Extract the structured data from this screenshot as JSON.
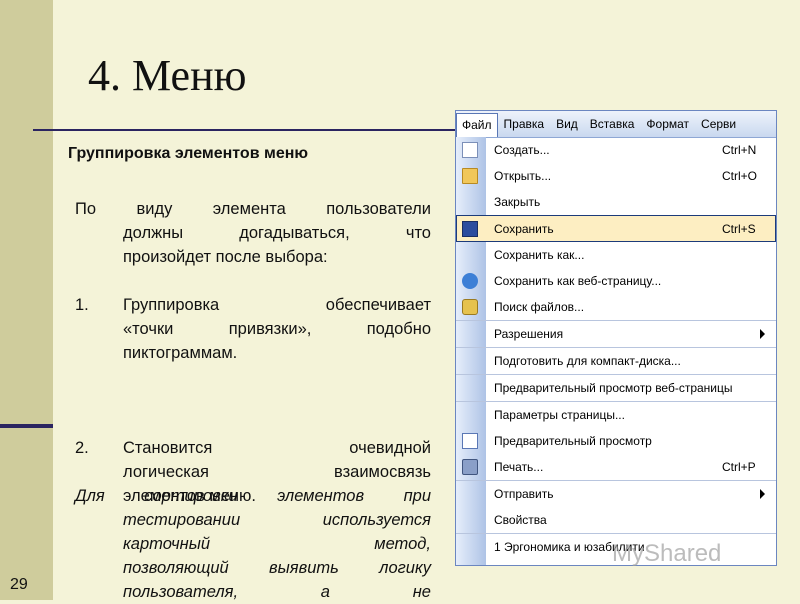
{
  "slide": {
    "title": "4. Меню",
    "subtitle": "Группировка элементов меню",
    "paragraph1": {
      "line1": "По виду элемента пользователи",
      "line2": "должны догадываться, что",
      "line3": "произойдет после выбора:"
    },
    "list": [
      {
        "num": "1.",
        "line1": "Группировка обеспечивает",
        "line2": "«точки привязки», подобно",
        "line3": "пиктограммам."
      },
      {
        "num": "2.",
        "line1": "Становится очевидной",
        "line2": "логическая взаимосвязь",
        "line3": "элементов меню."
      }
    ],
    "paragraph2": {
      "line1": "Для сортировки элементов при",
      "line2": "тестировании используется",
      "line3": "карточный метод,",
      "line4": "позволяющий выявить логику",
      "line5": "пользователя, а не"
    },
    "page_number": "29",
    "watermark": "MyShared"
  },
  "menu": {
    "menubar": [
      "Файл",
      "Правка",
      "Вид",
      "Вставка",
      "Формат",
      "Серви"
    ],
    "items": [
      {
        "label": "Создать...",
        "shortcut": "Ctrl+N",
        "icon": "new-document-icon"
      },
      {
        "label": "Открыть...",
        "shortcut": "Ctrl+O",
        "icon": "open-folder-icon"
      },
      {
        "label": "Закрыть",
        "shortcut": "",
        "icon": ""
      },
      {
        "label": "Сохранить",
        "shortcut": "Ctrl+S",
        "icon": "save-disk-icon",
        "highlighted": true
      },
      {
        "label": "Сохранить как...",
        "shortcut": "",
        "icon": ""
      },
      {
        "label": "Сохранить как веб-страницу...",
        "shortcut": "",
        "icon": "web-page-icon"
      },
      {
        "label": "Поиск файлов...",
        "shortcut": "",
        "icon": "file-search-icon"
      },
      {
        "label": "Разрешения",
        "shortcut": "",
        "icon": "",
        "submenu": true
      },
      {
        "label": "Подготовить для компакт-диска...",
        "shortcut": "",
        "icon": ""
      },
      {
        "label": "Предварительный просмотр веб-страницы",
        "shortcut": "",
        "icon": ""
      },
      {
        "label": "Параметры страницы...",
        "shortcut": "",
        "icon": ""
      },
      {
        "label": "Предварительный просмотр",
        "shortcut": "",
        "icon": "print-preview-icon"
      },
      {
        "label": "Печать...",
        "shortcut": "Ctrl+P",
        "icon": "printer-icon"
      },
      {
        "label": "Отправить",
        "shortcut": "",
        "icon": "",
        "submenu": true
      },
      {
        "label": "Свойства",
        "shortcut": "",
        "icon": ""
      },
      {
        "label": "1 Эргономика и юзабилити",
        "shortcut": "",
        "icon": ""
      }
    ]
  }
}
